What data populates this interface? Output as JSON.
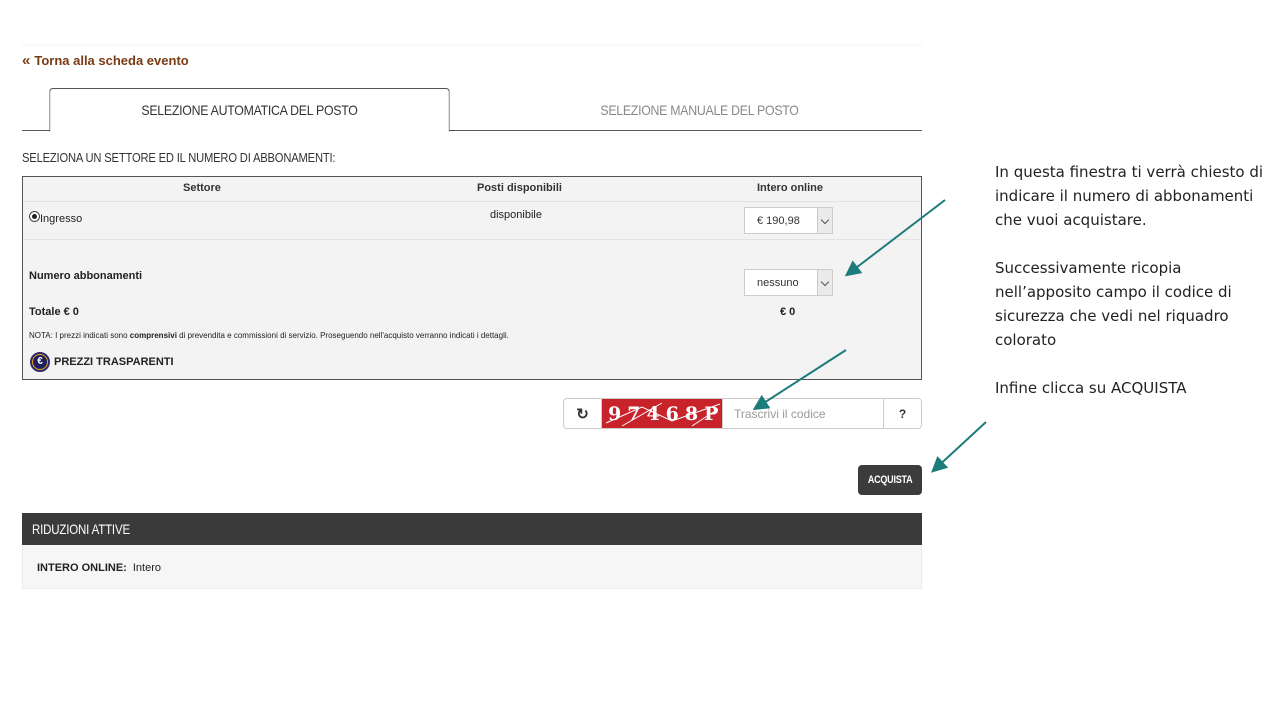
{
  "back_link": {
    "chevron": "«",
    "label": "Torna alla scheda evento"
  },
  "tabs": [
    {
      "label": "SELEZIONE AUTOMATICA DEL POSTO",
      "active": true
    },
    {
      "label": "SELEZIONE MANUALE DEL POSTO",
      "active": false
    }
  ],
  "section_title": "SELEZIONA UN SETTORE ED IL NUMERO DI ABBONAMENTI:",
  "table": {
    "headers": [
      "Settore",
      "Posti disponibili",
      "Intero online"
    ],
    "rows": [
      {
        "sector": "Ingresso",
        "availability": "disponibile",
        "price": "€ 190,98",
        "selected": true
      }
    ]
  },
  "quantity": {
    "label": "Numero abbonamenti",
    "value": "nessuno"
  },
  "total": {
    "label": "Totale € 0",
    "value": "€ 0"
  },
  "note": {
    "prefix": "NOTA: I prezzi indicati sono ",
    "bold": "comprensivi",
    "suffix": " di prevendita e commissioni di servizio. Proseguendo nell'acquisto verranno indicati i dettagli."
  },
  "transparent_prices": {
    "icon": "€",
    "label": "PREZZI TRASPARENTI"
  },
  "captcha": {
    "refresh_icon": "↻",
    "code_image_text": "97468P",
    "placeholder": "Trascrivi il codice",
    "help_label": "?"
  },
  "buy_button": {
    "label": "ACQUISTA"
  },
  "reductions": {
    "title": "RIDUZIONI ATTIVE",
    "items": [
      {
        "name": "INTERO ONLINE:",
        "value": "Intero"
      }
    ]
  },
  "annotation": {
    "paragraphs": [
      "In questa finestra ti verrà chiesto di indicare il numero di abbonamenti che vuoi acquistare.",
      "Successivamente ricopia nell’apposito campo il codice di sicurezza che vedi nel riquadro colorato",
      "Infine clicca su ACQUISTA"
    ]
  },
  "colors": {
    "back_link": "#7a3b14",
    "captcha_bg": "#c8222a",
    "dark_bar": "#3a3a3a",
    "arrow": "#1e7b7b"
  }
}
